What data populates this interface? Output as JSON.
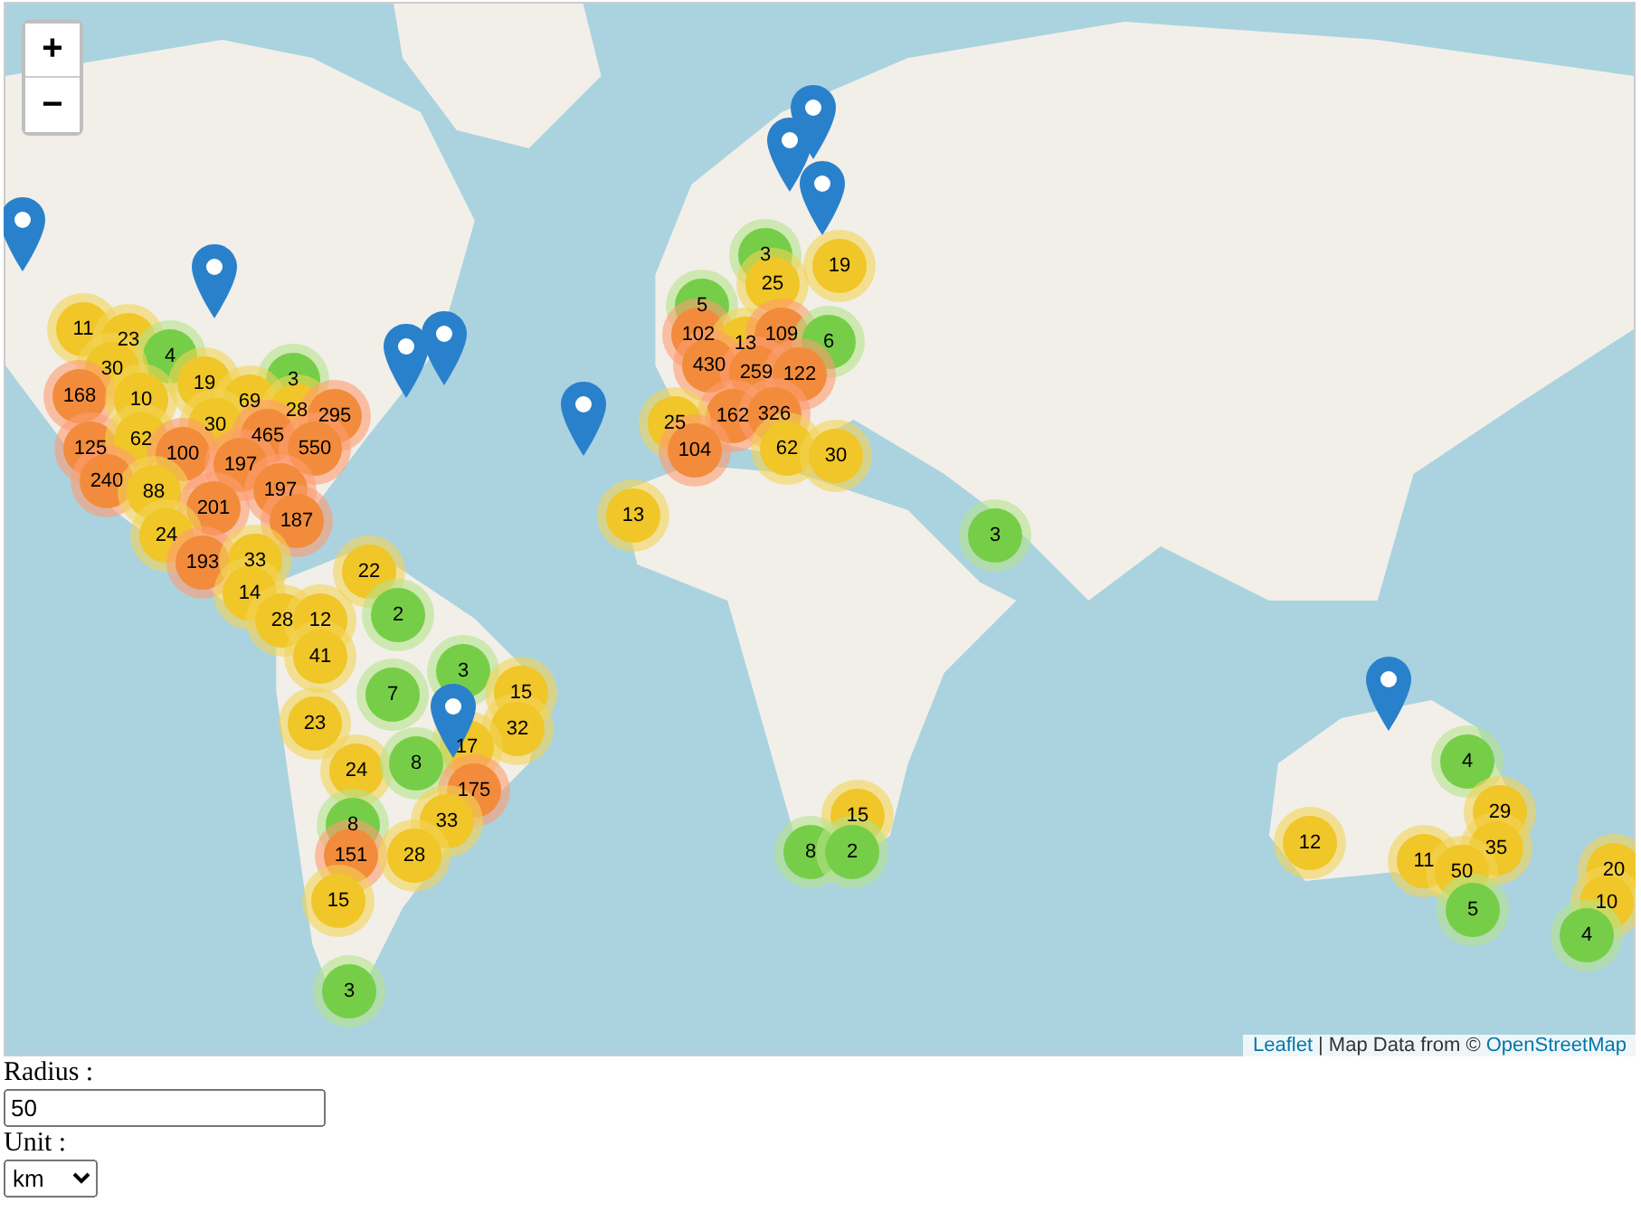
{
  "map": {
    "zoom_in": "+",
    "zoom_out": "−",
    "clusters": [
      {
        "count": "3",
        "kind": "small"
      },
      {
        "count": "19",
        "kind": "medium"
      },
      {
        "count": "25",
        "kind": "medium"
      },
      {
        "count": "5",
        "kind": "small"
      },
      {
        "count": "11",
        "kind": "medium"
      },
      {
        "count": "23",
        "kind": "medium"
      },
      {
        "count": "102",
        "kind": "large"
      },
      {
        "count": "13",
        "kind": "medium"
      },
      {
        "count": "109",
        "kind": "large"
      },
      {
        "count": "6",
        "kind": "small"
      },
      {
        "count": "4",
        "kind": "small"
      },
      {
        "count": "30",
        "kind": "medium"
      },
      {
        "count": "19",
        "kind": "medium"
      },
      {
        "count": "3",
        "kind": "small"
      },
      {
        "count": "430",
        "kind": "large"
      },
      {
        "count": "259",
        "kind": "large"
      },
      {
        "count": "122",
        "kind": "large"
      },
      {
        "count": "168",
        "kind": "large"
      },
      {
        "count": "10",
        "kind": "medium"
      },
      {
        "count": "69",
        "kind": "medium"
      },
      {
        "count": "28",
        "kind": "medium"
      },
      {
        "count": "295",
        "kind": "large"
      },
      {
        "count": "162",
        "kind": "large"
      },
      {
        "count": "326",
        "kind": "large"
      },
      {
        "count": "30",
        "kind": "medium"
      },
      {
        "count": "25",
        "kind": "medium"
      },
      {
        "count": "125",
        "kind": "large"
      },
      {
        "count": "62",
        "kind": "medium"
      },
      {
        "count": "100",
        "kind": "large"
      },
      {
        "count": "465",
        "kind": "large"
      },
      {
        "count": "550",
        "kind": "large"
      },
      {
        "count": "104",
        "kind": "large"
      },
      {
        "count": "62",
        "kind": "medium"
      },
      {
        "count": "30",
        "kind": "medium"
      },
      {
        "count": "197",
        "kind": "large"
      },
      {
        "count": "240",
        "kind": "large"
      },
      {
        "count": "88",
        "kind": "medium"
      },
      {
        "count": "197",
        "kind": "large"
      },
      {
        "count": "201",
        "kind": "large"
      },
      {
        "count": "187",
        "kind": "large"
      },
      {
        "count": "13",
        "kind": "medium"
      },
      {
        "count": "24",
        "kind": "medium"
      },
      {
        "count": "3",
        "kind": "small"
      },
      {
        "count": "193",
        "kind": "large"
      },
      {
        "count": "33",
        "kind": "medium"
      },
      {
        "count": "22",
        "kind": "medium"
      },
      {
        "count": "14",
        "kind": "medium"
      },
      {
        "count": "28",
        "kind": "medium"
      },
      {
        "count": "12",
        "kind": "medium"
      },
      {
        "count": "2",
        "kind": "small"
      },
      {
        "count": "41",
        "kind": "medium"
      },
      {
        "count": "3",
        "kind": "small"
      },
      {
        "count": "7",
        "kind": "small"
      },
      {
        "count": "15",
        "kind": "medium"
      },
      {
        "count": "23",
        "kind": "medium"
      },
      {
        "count": "32",
        "kind": "medium"
      },
      {
        "count": "17",
        "kind": "medium"
      },
      {
        "count": "24",
        "kind": "medium"
      },
      {
        "count": "8",
        "kind": "small"
      },
      {
        "count": "4",
        "kind": "small"
      },
      {
        "count": "175",
        "kind": "large"
      },
      {
        "count": "8",
        "kind": "small"
      },
      {
        "count": "33",
        "kind": "medium"
      },
      {
        "count": "15",
        "kind": "medium"
      },
      {
        "count": "29",
        "kind": "medium"
      },
      {
        "count": "151",
        "kind": "large"
      },
      {
        "count": "28",
        "kind": "medium"
      },
      {
        "count": "8",
        "kind": "small"
      },
      {
        "count": "2",
        "kind": "small"
      },
      {
        "count": "12",
        "kind": "medium"
      },
      {
        "count": "35",
        "kind": "medium"
      },
      {
        "count": "11",
        "kind": "medium"
      },
      {
        "count": "50",
        "kind": "medium"
      },
      {
        "count": "20",
        "kind": "medium"
      },
      {
        "count": "15",
        "kind": "medium"
      },
      {
        "count": "5",
        "kind": "small"
      },
      {
        "count": "10",
        "kind": "medium"
      },
      {
        "count": "4",
        "kind": "small"
      },
      {
        "count": "3",
        "kind": "small"
      }
    ],
    "attribution": {
      "link": "Leaflet",
      "text": "| Map Data from ©",
      "source": "OpenStreetMap"
    }
  },
  "form": {
    "radius_label": "Radius :",
    "radius_value": "50",
    "unit_label": "Unit :",
    "unit_value": "km"
  }
}
